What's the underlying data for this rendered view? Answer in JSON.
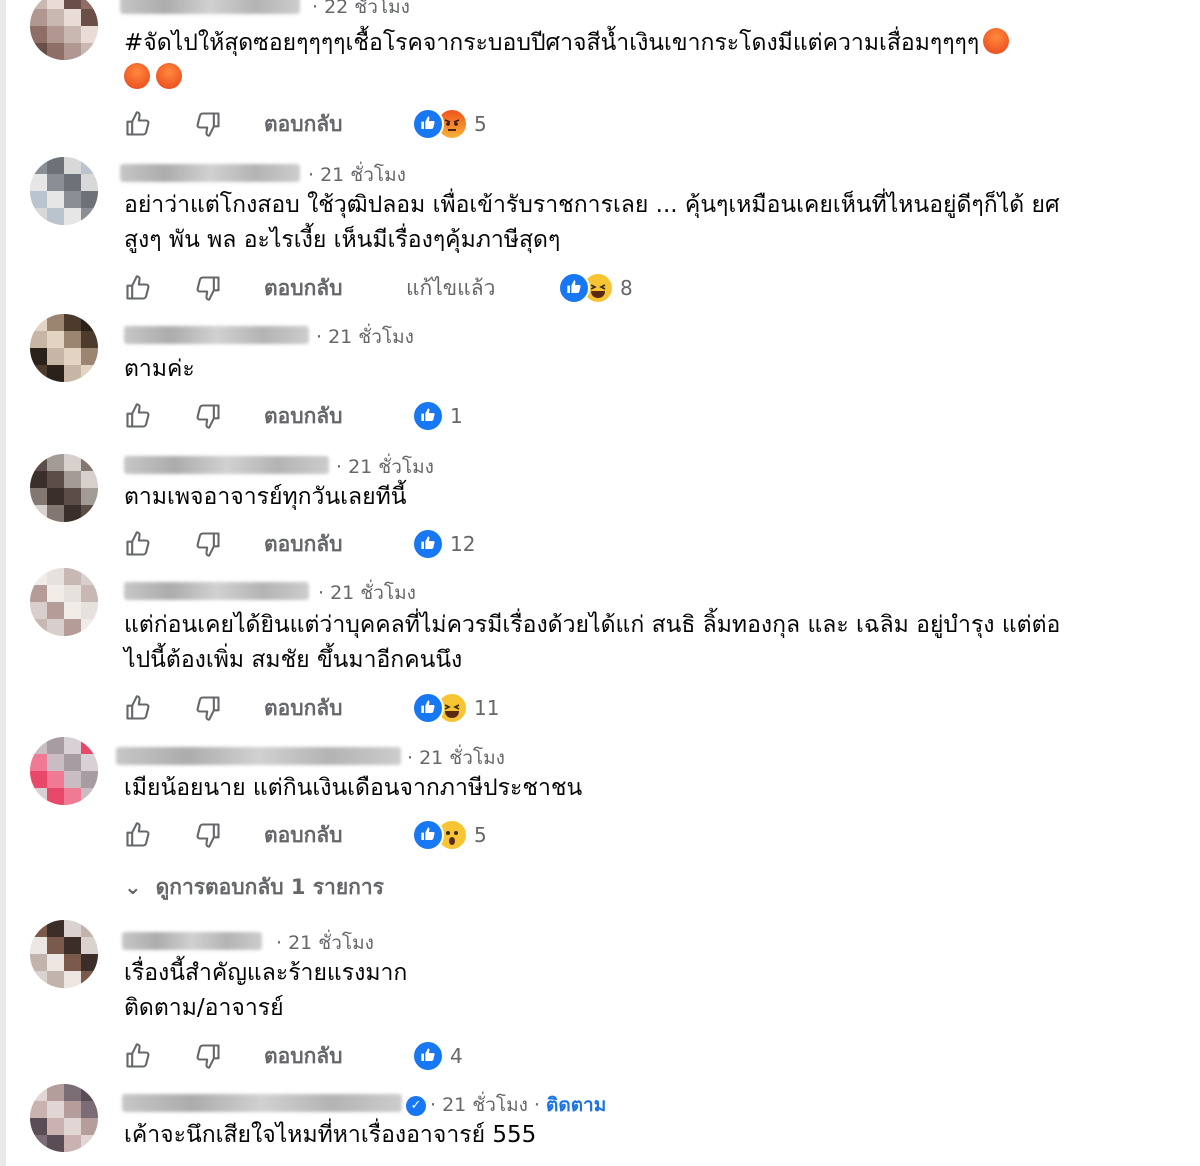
{
  "reply_label": "ตอบกลับ",
  "edited_label": "แก้ไขแล้ว",
  "follow_label": "ติดตาม",
  "comments": [
    {
      "time": "22 ชั่วโมง",
      "text_lines": [
        "#จัดไปให้สุดซอยๆๆๆๆเชื้อโรคจากระบอบปีศาจสีน้ำเงินเขากระโดงมีแต่ความเสื่อมๆๆๆๆ"
      ],
      "inline_emojis": [
        "angry-emoji",
        "angry-emoji",
        "angry-emoji"
      ],
      "reactions": [
        "like-icon",
        "angry-icon"
      ],
      "reaction_count": "5"
    },
    {
      "time": "21 ชั่วโมง",
      "text_lines": [
        "อย่าว่าแต่โกงสอบ ใช้วุฒิปลอม เพื่อเข้ารับราชการเลย ... คุ้นๆเหมือนเคยเห็นที่ไหนอยู่ดีๆก็ได้ ยศ",
        "สูงๆ พัน พล อะไรเงี้ย เห็นมีเรื่องๆคุ้มภาษีสุดๆ"
      ],
      "edited": true,
      "reactions": [
        "like-icon",
        "haha-icon"
      ],
      "reaction_count": "8"
    },
    {
      "time": "21 ชั่วโมง",
      "text_lines": [
        "ตามค่ะ"
      ],
      "reactions": [
        "like-icon"
      ],
      "reaction_count": "1"
    },
    {
      "time": "21 ชั่วโมง",
      "text_lines": [
        "ตามเพจอาจารย์ทุกวันเลยทีนี้"
      ],
      "reactions": [
        "like-icon"
      ],
      "reaction_count": "12"
    },
    {
      "time": "21 ชั่วโมง",
      "text_lines": [
        "แต่ก่อนเคยได้ยินแต่ว่าบุคคลที่ไม่ควรมีเรื่องด้วยได้แก่ สนธิ ลิ้มทองกุล และ เฉลิม อยู่บำรุง แต่ต่อ",
        "ไปนี้ต้องเพิ่ม สมชัย ขึ้นมาอีกคนนึง"
      ],
      "reactions": [
        "like-icon",
        "haha-icon"
      ],
      "reaction_count": "11"
    },
    {
      "time": "21 ชั่วโมง",
      "text_lines": [
        "เมียน้อยนาย แต่กินเงินเดือนจากภาษีประชาชน"
      ],
      "reactions": [
        "like-icon",
        "wow-icon"
      ],
      "reaction_count": "5",
      "view_replies": "ดูการตอบกลับ 1 รายการ"
    },
    {
      "time": "21 ชั่วโมง",
      "text_lines": [
        "เรื่องนี้สำคัญและร้ายแรงมาก",
        "ติดตาม/อาจารย์"
      ],
      "reactions": [
        "like-icon"
      ],
      "reaction_count": "4"
    },
    {
      "time": "21 ชั่วโมง",
      "text_lines": [
        "เค้าจะนึกเสียใจไหมที่หาเรื่องอาจารย์ 555"
      ],
      "verified": true,
      "follow": true
    }
  ],
  "colors": {
    "like": "#1877f2",
    "meta": "#65676b",
    "follow": "#1b74e4",
    "text": "#050505"
  }
}
